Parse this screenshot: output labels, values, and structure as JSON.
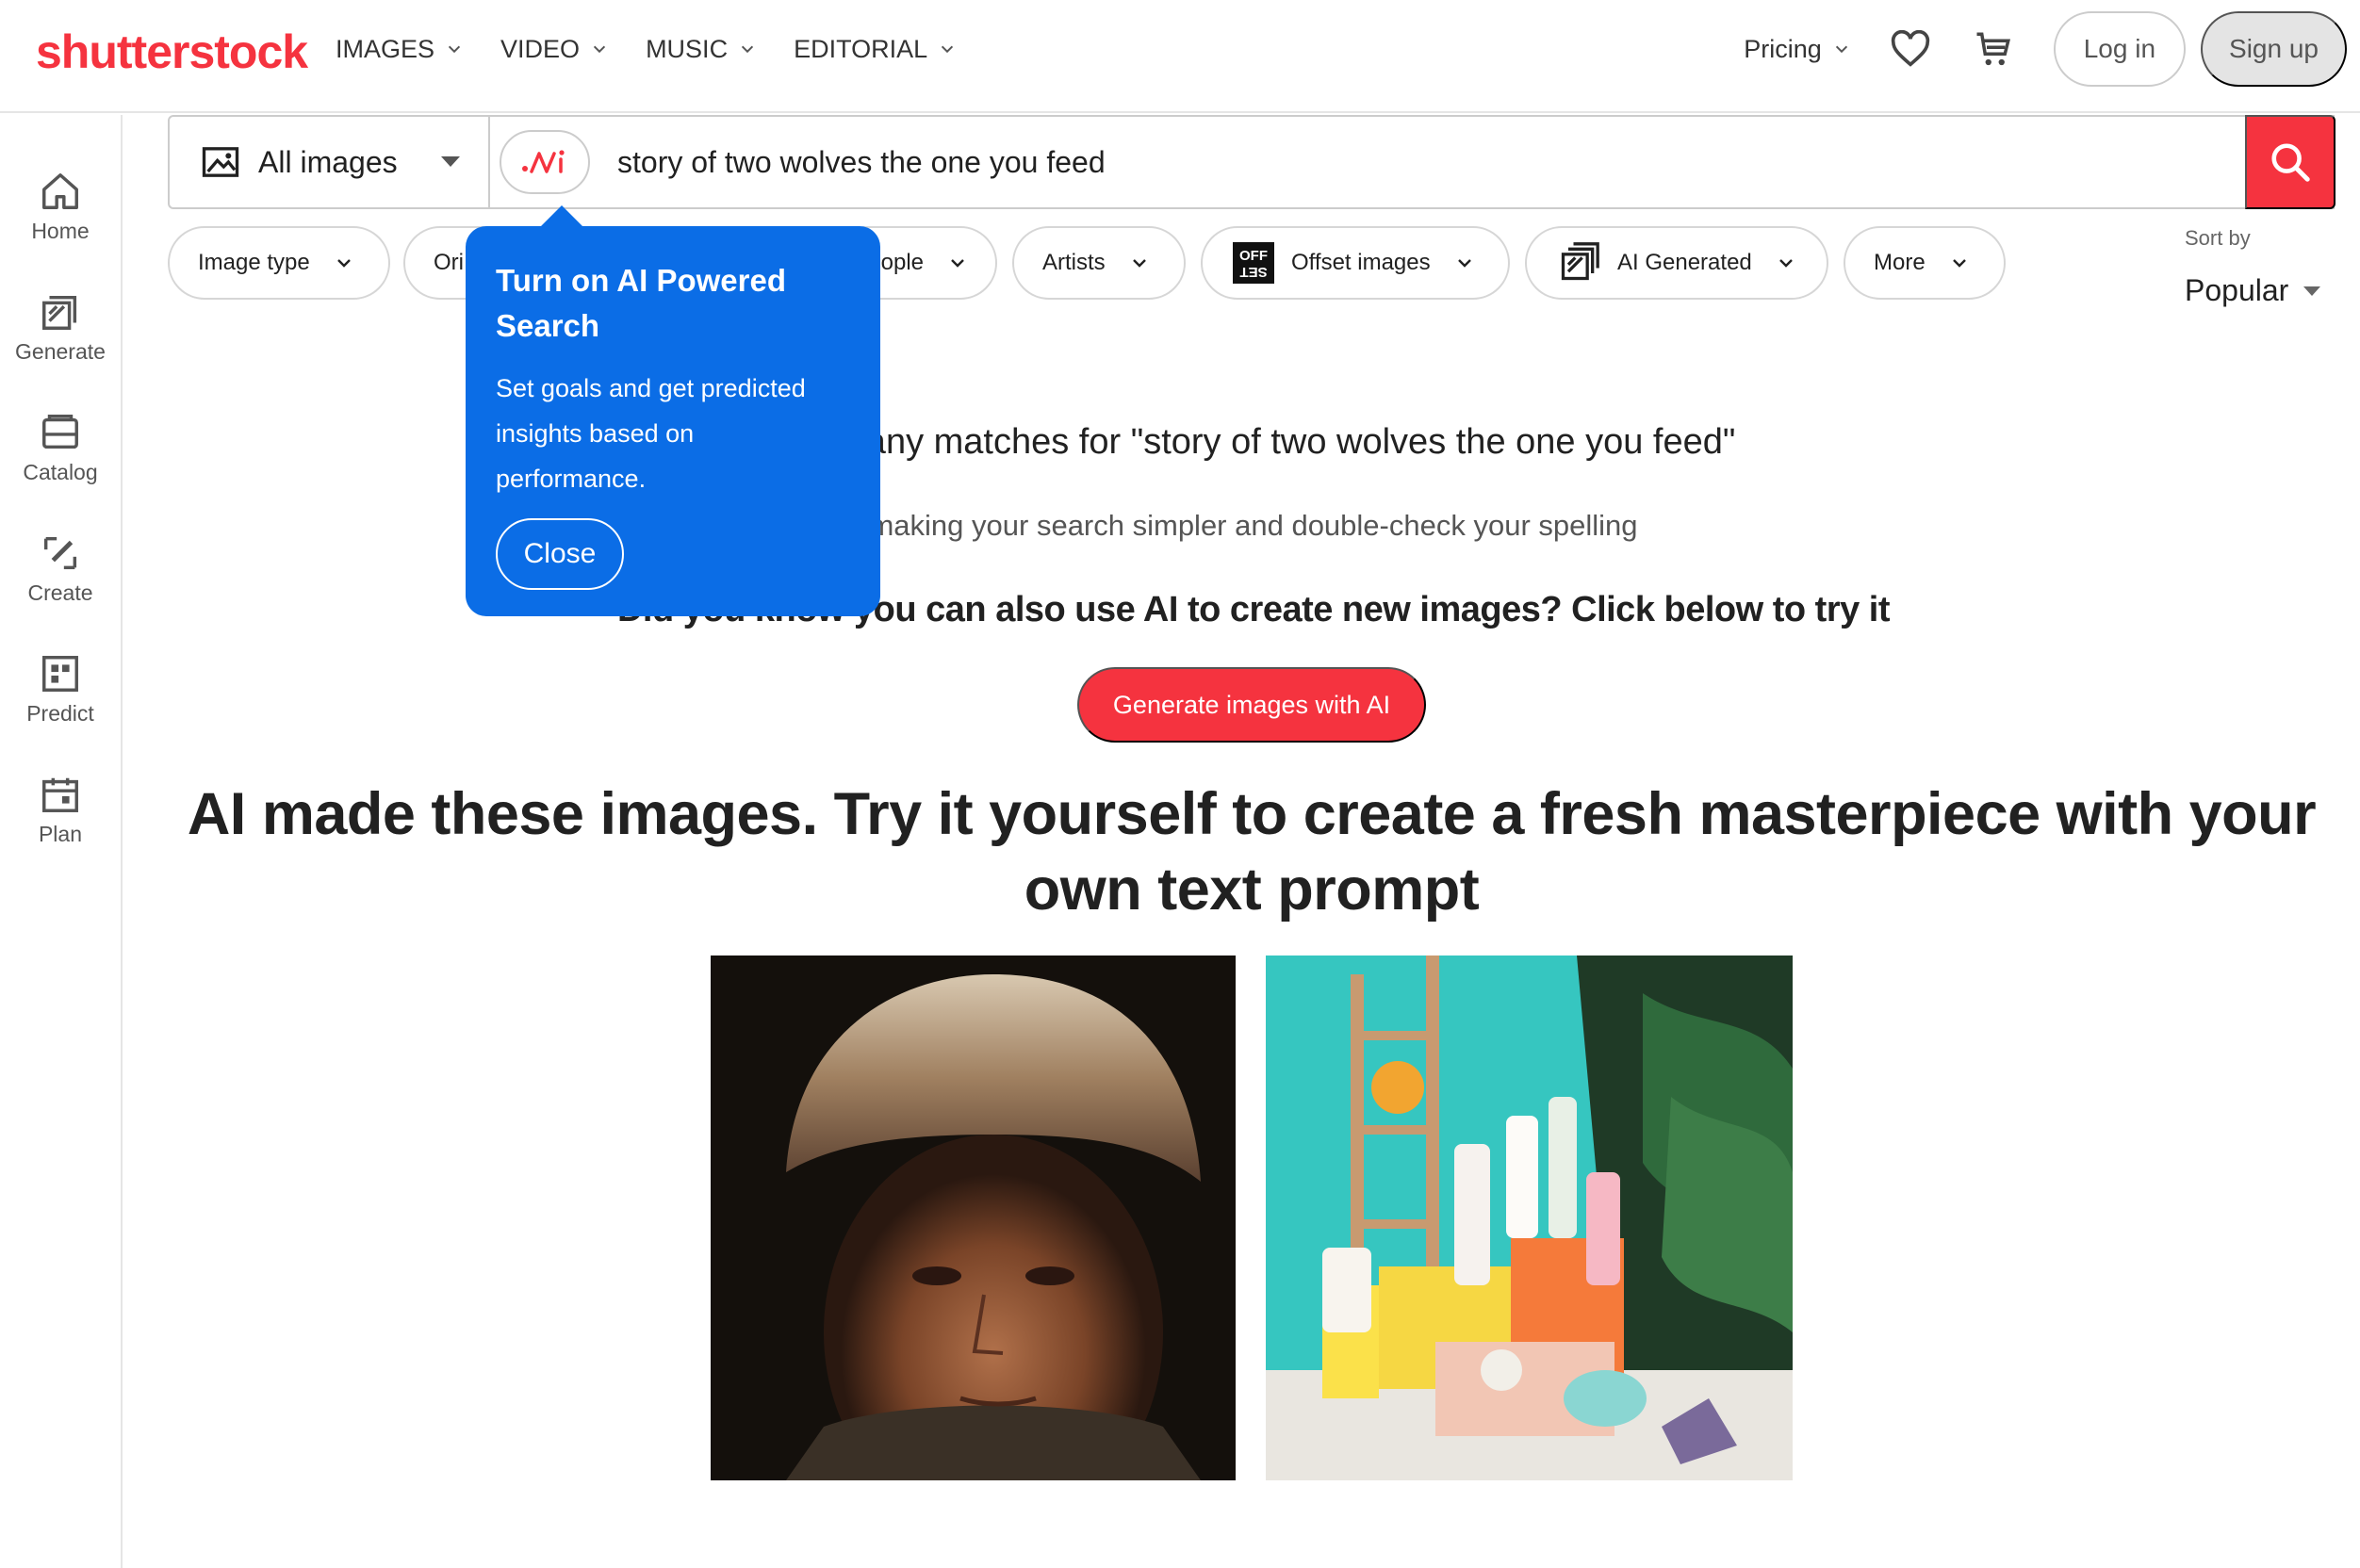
{
  "brand": {
    "logo_text": "shutterstock",
    "accent": "#f5333f",
    "tooltip_blue": "#0b6de6"
  },
  "topnav": {
    "items": [
      {
        "label": "IMAGES"
      },
      {
        "label": "VIDEO"
      },
      {
        "label": "MUSIC"
      },
      {
        "label": "EDITORIAL"
      }
    ],
    "pricing": "Pricing",
    "favorites_icon": "heart-icon",
    "cart_icon": "cart-icon",
    "login": "Log in",
    "signup": "Sign up"
  },
  "sidebar": {
    "items": [
      {
        "label": "Home",
        "icon": "home-icon"
      },
      {
        "label": "Generate",
        "icon": "generate-icon"
      },
      {
        "label": "Catalog",
        "icon": "catalog-icon"
      },
      {
        "label": "Create",
        "icon": "create-icon"
      },
      {
        "label": "Predict",
        "icon": "predict-icon"
      },
      {
        "label": "Plan",
        "icon": "plan-icon"
      }
    ]
  },
  "search": {
    "scope": "All images",
    "query": "story of two wolves the one you feed",
    "ai_toggle_icon": "ai-icon",
    "submit_icon": "search-icon"
  },
  "filters": {
    "image_type": "Image type",
    "orientation": "Ori",
    "people": "ople",
    "artists": "Artists",
    "offset": "Offset images",
    "offset_badge_top": "OFF",
    "offset_badge_bottom": "SET",
    "ai_generated": "AI Generated",
    "more": "More"
  },
  "sort": {
    "label": "Sort by",
    "value": "Popular"
  },
  "results": {
    "no_match": "'t find any matches for \"story of two wolves the one you feed\"",
    "hint": "making your search simpler and double-check your spelling",
    "did_you_know": "Did you know you can also use AI to create new images? Click below to try it",
    "generate_button": "Generate images with AI",
    "headline": "AI made these images. Try it yourself to create a fresh masterpiece with your own text prompt"
  },
  "tooltip": {
    "title": "Turn on AI Powered Search",
    "body": "Set goals and get predicted insights based on performance.",
    "close": "Close"
  }
}
